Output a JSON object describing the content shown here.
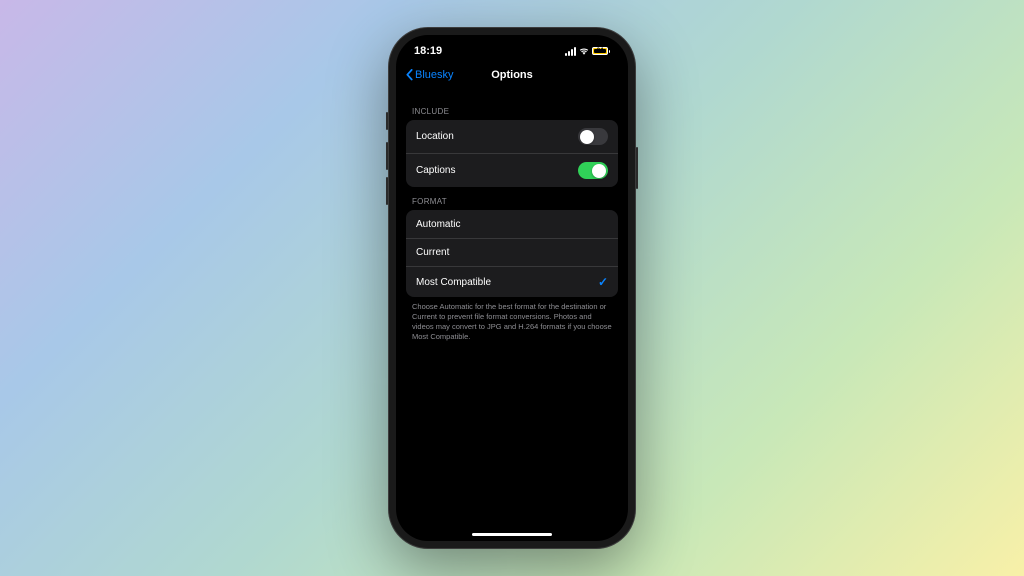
{
  "status": {
    "time": "18:19",
    "battery": "24"
  },
  "nav": {
    "back_label": "Bluesky",
    "title": "Options"
  },
  "sections": {
    "include": {
      "header": "INCLUDE",
      "rows": [
        {
          "label": "Location",
          "on": false
        },
        {
          "label": "Captions",
          "on": true
        }
      ]
    },
    "format": {
      "header": "FORMAT",
      "rows": [
        {
          "label": "Automatic",
          "selected": false
        },
        {
          "label": "Current",
          "selected": false
        },
        {
          "label": "Most Compatible",
          "selected": true
        }
      ],
      "footer": "Choose Automatic for the best format for the destination or Current to prevent file format conversions. Photos and videos may convert to JPG and H.264 formats if you choose Most Compatible."
    }
  }
}
